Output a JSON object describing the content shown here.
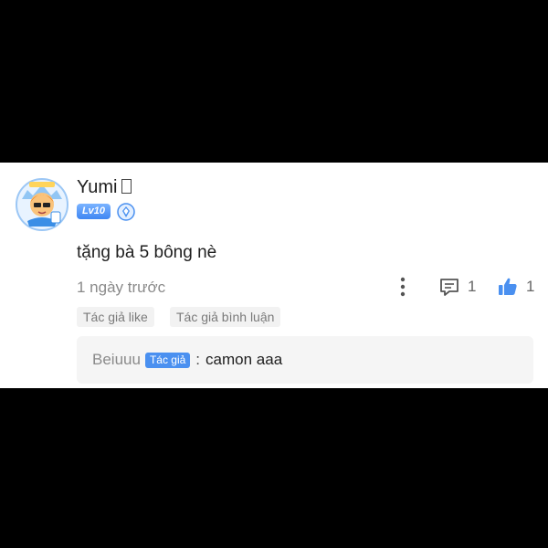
{
  "comment": {
    "username": "Yumi",
    "level_badge": "Lv10",
    "text": "tặng bà 5 bông nè",
    "timestamp": "1 ngày trước",
    "reply_count": "1",
    "like_count": "1",
    "tags": [
      "Tác giả like",
      "Tác giả bình luận"
    ]
  },
  "reply": {
    "author": "Beiuuu",
    "author_badge": "Tác giả",
    "separator": ":",
    "text": "camon aaa"
  },
  "icons": {
    "avatar": "avatar-image",
    "verify": "shield-verify-icon",
    "more": "more-vertical-icon",
    "reply": "comment-icon",
    "like": "thumbs-up-icon"
  },
  "colors": {
    "accent": "#4a90f0",
    "badge_gradient_top": "#7ab3ff",
    "badge_gradient_bottom": "#3f86f3"
  }
}
